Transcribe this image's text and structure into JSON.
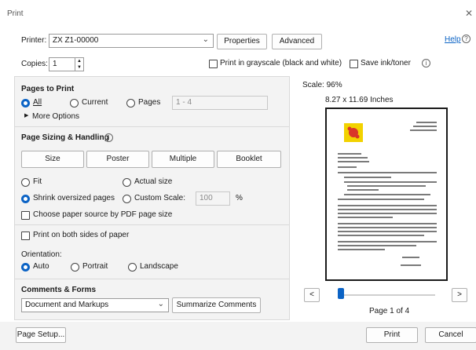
{
  "window": {
    "title": "Print",
    "close_glyph": "✕"
  },
  "printer": {
    "label": "Printer:",
    "value": "ZX Z1-00000",
    "properties_label": "Properties",
    "advanced_label": "Advanced"
  },
  "help": {
    "label": "Help",
    "icon": "question-circle"
  },
  "copies": {
    "label": "Copies:",
    "value": "1"
  },
  "options": {
    "grayscale_label": "Print in grayscale (black and white)",
    "save_ink_label": "Save ink/toner"
  },
  "pages_to_print": {
    "title": "Pages to Print",
    "all_label": "All",
    "current_label": "Current",
    "pages_label": "Pages",
    "pages_range": "1 - 4",
    "more_options_label": "More Options",
    "selected": "all"
  },
  "sizing": {
    "title": "Page Sizing & Handling",
    "size_label": "Size",
    "poster_label": "Poster",
    "multiple_label": "Multiple",
    "booklet_label": "Booklet",
    "fit_label": "Fit",
    "actual_label": "Actual size",
    "shrink_label": "Shrink oversized pages",
    "custom_label": "Custom Scale:",
    "custom_value": "100",
    "percent": "%",
    "paper_source_label": "Choose paper source by PDF page size",
    "selected": "shrink"
  },
  "duplex": {
    "label": "Print on both sides of paper"
  },
  "orientation": {
    "title": "Orientation:",
    "auto_label": "Auto",
    "portrait_label": "Portrait",
    "landscape_label": "Landscape",
    "selected": "auto"
  },
  "comments": {
    "title": "Comments & Forms",
    "value": "Document and Markups",
    "summarize_label": "Summarize Comments"
  },
  "preview": {
    "scale": "Scale: 96%",
    "paper_size": "8.27 x 11.69 Inches",
    "page_indicator": "Page 1 of 4",
    "prev_glyph": "<",
    "next_glyph": ">",
    "slider_position": 0
  },
  "footer": {
    "page_setup_label": "Page Setup...",
    "print_label": "Print",
    "cancel_label": "Cancel"
  },
  "colors": {
    "accent": "#0b63c5",
    "logo_yellow": "#f2d200",
    "logo_red": "#d9352a"
  }
}
